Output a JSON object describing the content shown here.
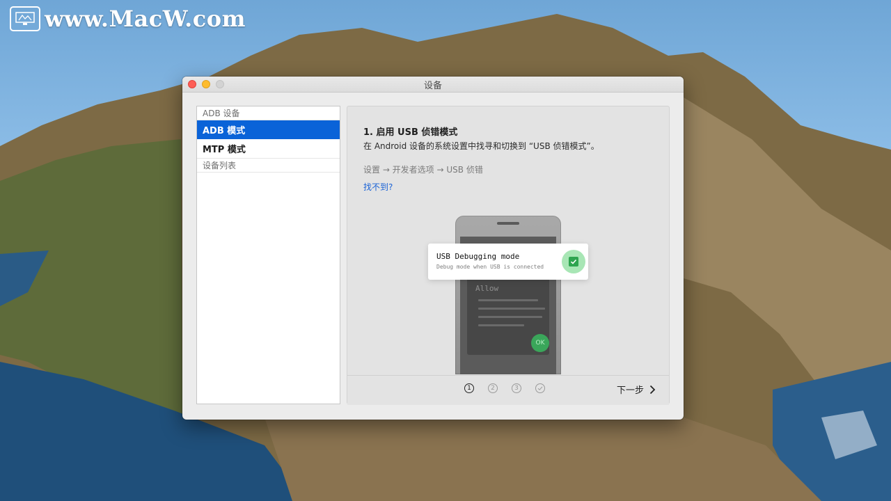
{
  "watermark": {
    "text": "www.MacW.com"
  },
  "window": {
    "title": "设备"
  },
  "sidebar": {
    "section_adb": "ADB 设备",
    "item_adb": "ADB 模式",
    "item_mtp": "MTP 模式",
    "section_devices": "设备列表"
  },
  "main": {
    "step_title": "1. 启用 USB 侦错模式",
    "step_desc": "在 Android 设备的系统设置中找寻和切换到 “USB 侦错模式”。",
    "path": "设置 → 开发者选项 → USB 侦错",
    "help_link": "找不到?"
  },
  "illustration": {
    "dialog_title": "Allow",
    "ok_label": "OK",
    "card_title": "USB Debugging mode",
    "card_subtitle": "Debug mode when USB is connected"
  },
  "footer": {
    "steps": [
      "1",
      "2",
      "3"
    ],
    "next_label": "下一步"
  },
  "colors": {
    "accent": "#0a63d8",
    "link": "#1b63d6",
    "success": "#2ea44f"
  }
}
